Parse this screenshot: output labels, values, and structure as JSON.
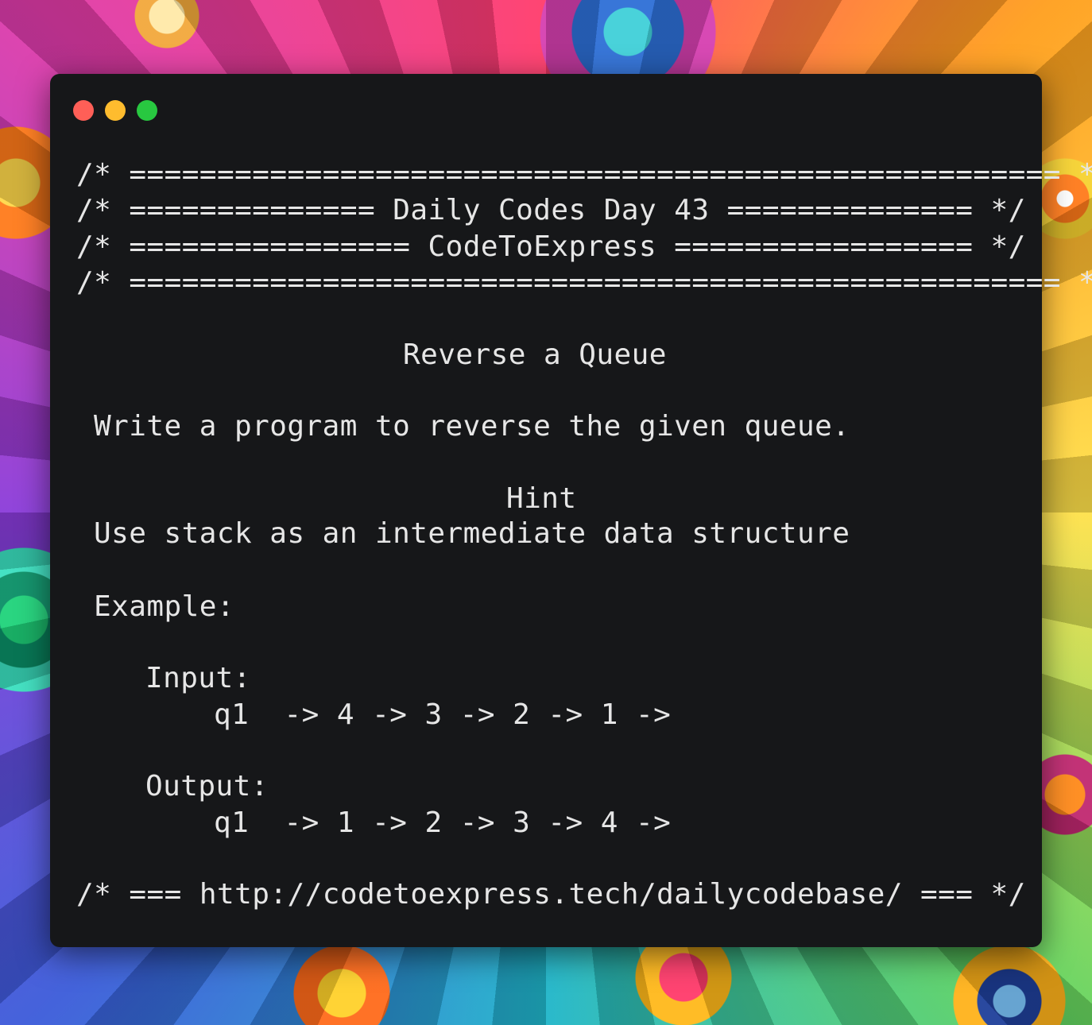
{
  "window": {
    "controls": {
      "close_color": "#ff5f57",
      "minimize_color": "#febc2e",
      "maximize_color": "#28c840"
    },
    "background_color": "#161719",
    "text_color": "#e6e6e6"
  },
  "code": {
    "header": [
      "/* ===================================================== */",
      "/* ============== Daily Codes Day 43 ============== */",
      "/* ================ CodeToExpress ================= */",
      "/* ===================================================== */"
    ],
    "title": "Reverse a Queue",
    "description": "Write a program to reverse the given queue.",
    "hint_label": "Hint",
    "hint_text": "Use stack as an intermediate data structure",
    "example_label": "Example:",
    "input_label": "Input:",
    "input_value": "q1  -> 4 -> 3 -> 2 -> 1 ->",
    "output_label": "Output:",
    "output_value": "q1  -> 1 -> 2 -> 3 -> 4 ->",
    "footer": "/* === http://codetoexpress.tech/dailycodebase/ === */"
  }
}
